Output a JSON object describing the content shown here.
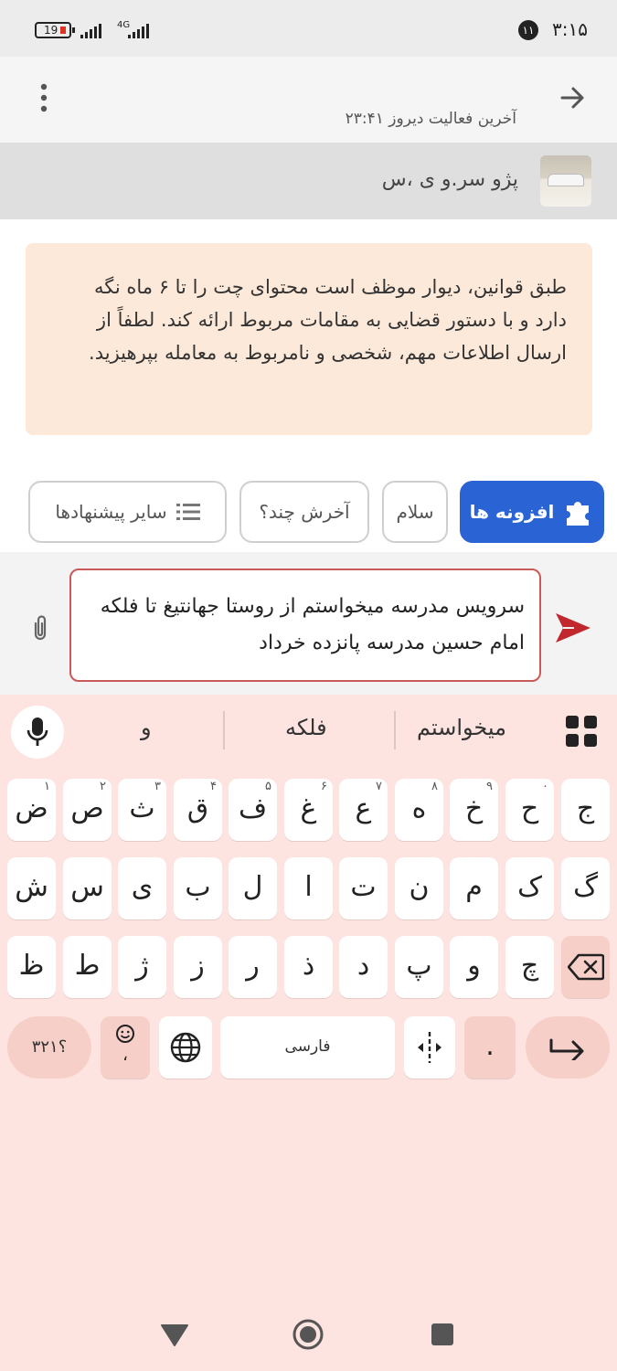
{
  "status_bar": {
    "time": "۳:۱۵",
    "notification_count": "۱۱",
    "battery": "19",
    "network": "4G"
  },
  "header": {
    "last_activity": "آخرین فعالیت دیروز ۲۳:۴۱"
  },
  "ad": {
    "title": "پژو سر.و ی ،س"
  },
  "warning": {
    "text": "طبق قوانین، دیوار موظف است محتوای چت را تا ۶ ماه نگه دارد و با دستور قضایی به مقامات مربوط ارائه کند. لطفاً از ارسال اطلاعات مهم، شخصی و نامربوط به معامله بپرهیزید."
  },
  "chips": {
    "addons": "افزونه ها",
    "hello": "سلام",
    "last_price": "آخرش چند؟",
    "other": "سایر پیشنهادها"
  },
  "composer": {
    "message": "سرویس مدرسه میخواستم از روستا جهانتیغ تا فلکه امام حسین مدرسه پانزده خرداد"
  },
  "keyboard": {
    "suggestions": [
      "میخواستم",
      "فلکه",
      "و"
    ],
    "row1": [
      {
        "k": "ج",
        "h": ""
      },
      {
        "k": "ح",
        "h": "۰"
      },
      {
        "k": "خ",
        "h": "۹"
      },
      {
        "k": "ه",
        "h": "۸"
      },
      {
        "k": "ع",
        "h": "۷"
      },
      {
        "k": "غ",
        "h": "۶"
      },
      {
        "k": "ف",
        "h": "۵"
      },
      {
        "k": "ق",
        "h": "۴"
      },
      {
        "k": "ث",
        "h": "۳"
      },
      {
        "k": "ص",
        "h": "۲"
      },
      {
        "k": "ض",
        "h": "۱"
      }
    ],
    "row2": [
      "گ",
      "ک",
      "م",
      "ن",
      "ت",
      "ا",
      "ل",
      "ب",
      "ی",
      "س",
      "ش"
    ],
    "row3": [
      "چ",
      "و",
      "پ",
      "د",
      "ذ",
      "ر",
      "ز",
      "ژ",
      "ط",
      "ظ"
    ],
    "numbers_key": "؟۳۲۱",
    "emoji_sub": "،",
    "space_label": "فارسی",
    "dot_key": "."
  },
  "colors": {
    "primary": "#2a63d4",
    "send": "#c0282d",
    "keyboard_bg": "#fde4e1",
    "warning_bg": "#fde9d9"
  }
}
